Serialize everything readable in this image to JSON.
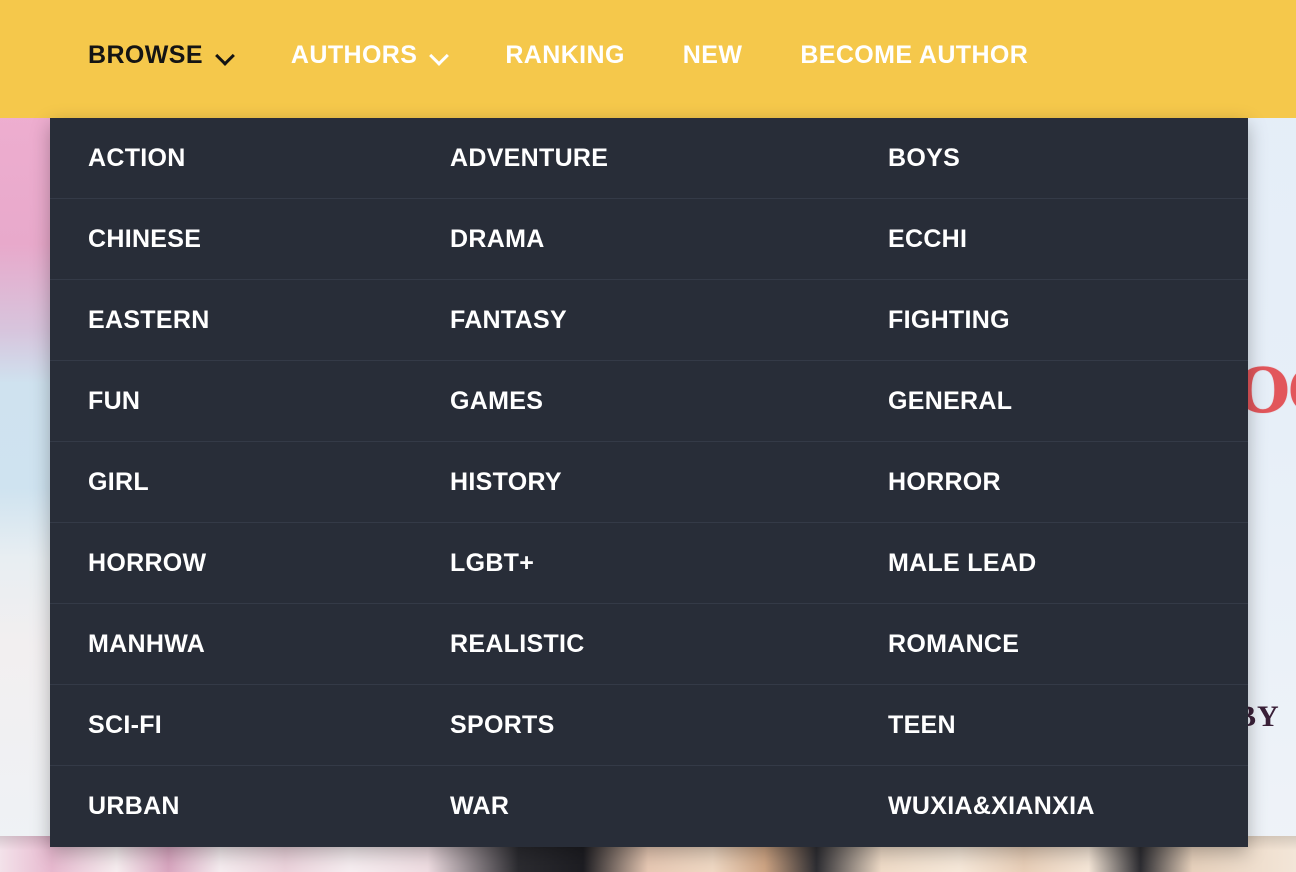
{
  "navbar": {
    "background_color": "#F5C84B",
    "items": [
      {
        "label": "BROWSE",
        "icon": "chevron-down-icon",
        "has_chevron": true,
        "active": true
      },
      {
        "label": "AUTHORS",
        "icon": "chevron-down-icon",
        "has_chevron": true,
        "active": false
      },
      {
        "label": "RANKING",
        "icon": "",
        "has_chevron": false,
        "active": false
      },
      {
        "label": "NEW",
        "icon": "",
        "has_chevron": false,
        "active": false
      },
      {
        "label": "BECOME AUTHOR",
        "icon": "",
        "has_chevron": false,
        "active": false
      }
    ]
  },
  "dropdown": {
    "open_for": "BROWSE",
    "background_color": "#282D38",
    "text_color": "#FFFFFF",
    "divider_color": "#343A47",
    "rows": [
      {
        "col1": "ACTION",
        "col2": "ADVENTURE",
        "col3": "BOYS"
      },
      {
        "col1": "CHINESE",
        "col2": "DRAMA",
        "col3": "ECCHI"
      },
      {
        "col1": "EASTERN",
        "col2": "FANTASY",
        "col3": "FIGHTING"
      },
      {
        "col1": "FUN",
        "col2": "GAMES",
        "col3": "GENERAL"
      },
      {
        "col1": "GIRL",
        "col2": "HISTORY",
        "col3": "HORROR"
      },
      {
        "col1": "HORROW",
        "col2": "LGBT+",
        "col3": "MALE LEAD"
      },
      {
        "col1": "MANHWA",
        "col2": "REALISTIC",
        "col3": "ROMANCE"
      },
      {
        "col1": "SCI-FI",
        "col2": "SPORTS",
        "col3": "TEEN"
      },
      {
        "col1": "URBAN",
        "col2": "WAR",
        "col3": "WUXIA&XIANXIA"
      }
    ]
  },
  "background": {
    "cover_letters": "OO IS C D",
    "cover_byline": "BY"
  }
}
